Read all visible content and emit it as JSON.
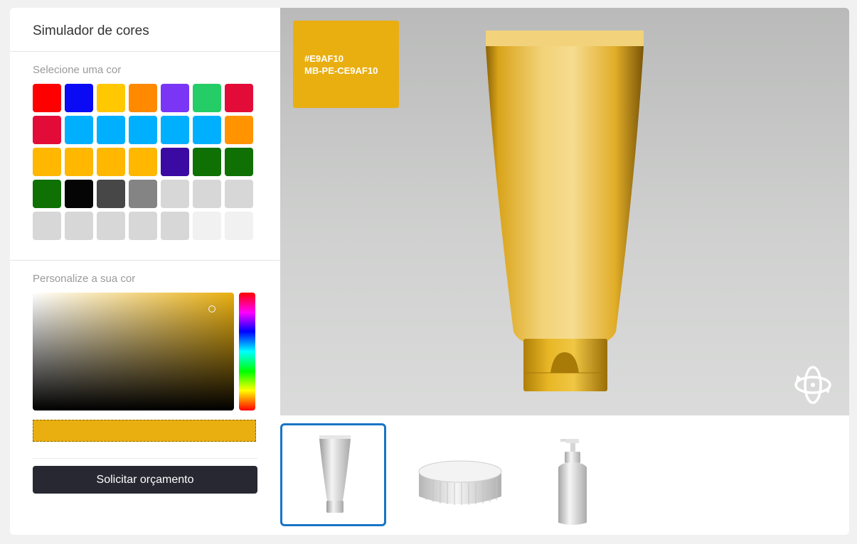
{
  "sidebar": {
    "title": "Simulador de cores",
    "palette_label": "Selecione uma cor",
    "custom_label": "Personalize a sua cor",
    "request_button": "Solicitar orçamento"
  },
  "palette": {
    "rows": [
      [
        "#ff0000",
        "#0a0af5",
        "#ffc800",
        "#ff8a00",
        "#7a35f5",
        "#25cd66",
        "#e30c38"
      ],
      [
        "#e30c38",
        "#00b0ff",
        "#00b0ff",
        "#00b0ff",
        "#00b0ff",
        "#00b0ff",
        "#ff9400"
      ],
      [
        "#ffb700",
        "#ffb700",
        "#ffb700",
        "#ffb700",
        "#3a0aa3",
        "#0f7004",
        "#0f7004"
      ],
      [
        "#0f7004",
        "#050505",
        "#474747",
        "#848484",
        "#d7d7d7",
        "#d7d7d7",
        "#d7d7d7"
      ],
      [
        "#d7d7d7",
        "#d7d7d7",
        "#d7d7d7",
        "#d7d7d7",
        "#d7d7d7",
        "#f1f1f1",
        "#f1f1f1"
      ]
    ]
  },
  "selected_color": {
    "hex": "#E9AF10",
    "code": "MB-PE-CE9AF10",
    "value": "#e9af10"
  },
  "product_thumbnails": [
    {
      "name": "tube",
      "active": true
    },
    {
      "name": "cap",
      "active": false
    },
    {
      "name": "pump-bottle",
      "active": false
    }
  ],
  "icons": {
    "rotate": "rotate-3d-icon"
  }
}
